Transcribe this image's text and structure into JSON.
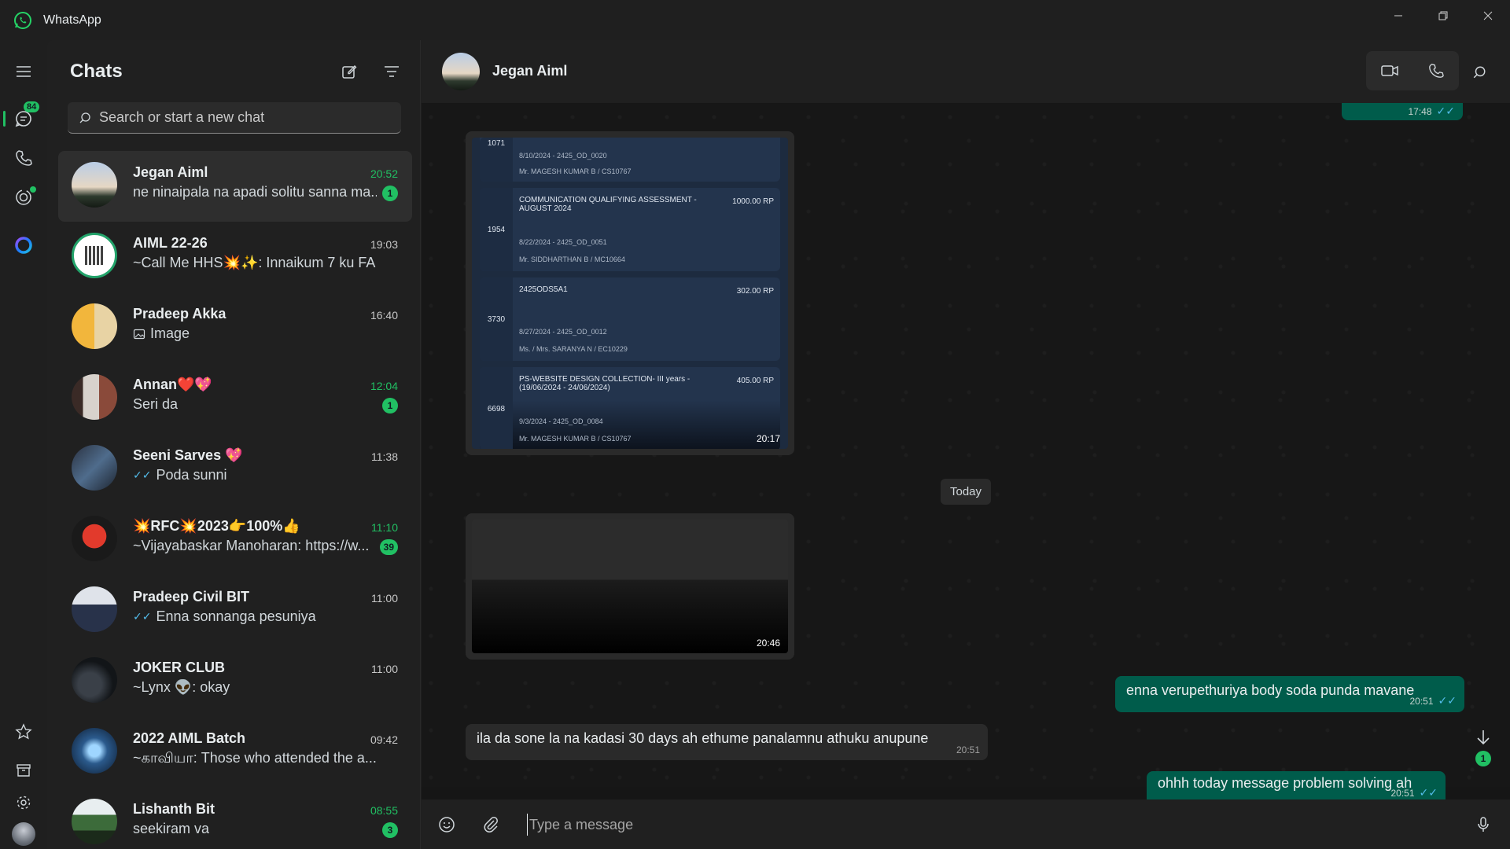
{
  "window": {
    "title": "WhatsApp",
    "controls": [
      "minimize",
      "restore",
      "close"
    ]
  },
  "rail": {
    "chats_badge": "84",
    "items": [
      {
        "name": "menu"
      },
      {
        "name": "chats"
      },
      {
        "name": "calls"
      },
      {
        "name": "status"
      },
      {
        "name": "meta-ai"
      },
      {
        "name": "starred"
      },
      {
        "name": "archived"
      },
      {
        "name": "settings"
      },
      {
        "name": "profile"
      }
    ]
  },
  "chatlist": {
    "title": "Chats",
    "search_placeholder": "Search or start a new chat",
    "chats": [
      {
        "name": "Jegan Aiml",
        "preview": "ne ninaipala na apadi solitu sanna ma...",
        "time": "20:52",
        "unread": "1",
        "has_ticks": false
      },
      {
        "name": "AIML 22-26",
        "preview": "~Call Me HHS💥✨: Innaikum 7 ku FA",
        "time": "19:03",
        "unread": "",
        "has_ticks": false
      },
      {
        "name": "Pradeep Akka",
        "preview": "Image",
        "time": "16:40",
        "unread": "",
        "has_ticks": false,
        "image_icon": true
      },
      {
        "name": "Annan❤️💖",
        "preview": "Seri da",
        "time": "12:04",
        "unread": "1",
        "has_ticks": false
      },
      {
        "name": "Seeni Sarves 💖",
        "preview": "Poda sunni",
        "time": "11:38",
        "unread": "",
        "has_ticks": true
      },
      {
        "name": "💥RFC💥2023👉100%👍",
        "preview": "~Vijayabaskar Manoharan: https://w...",
        "time": "11:10",
        "unread": "39",
        "has_ticks": false
      },
      {
        "name": "Pradeep Civil BIT",
        "preview": "Enna sonnanga pesuniya",
        "time": "11:00",
        "unread": "",
        "has_ticks": true
      },
      {
        "name": "JOKER CLUB",
        "preview": "~Lynx 👽: okay",
        "time": "11:00",
        "unread": "",
        "has_ticks": false
      },
      {
        "name": "2022 AIML Batch",
        "preview": "~காவியா: Those who attended the a...",
        "time": "09:42",
        "unread": "",
        "has_ticks": false
      },
      {
        "name": "Lishanth Bit",
        "preview": "seekiram va",
        "time": "08:55",
        "unread": "3",
        "has_ticks": false
      }
    ]
  },
  "conversation": {
    "contact_name": "Jegan Aiml",
    "top_partial_time": "17:48",
    "receipt_image": {
      "time": "20:17",
      "rows": [
        {
          "num": "1071",
          "line1": "",
          "amount": "",
          "line2": "8/10/2024 - 2425_OD_0020",
          "line3": "Mr. MAGESH KUMAR B / CS10767"
        },
        {
          "num": "1954",
          "line1": "COMMUNICATION QUALIFYING ASSESSMENT - AUGUST 2024",
          "amount": "1000.00 RP",
          "line2": "8/22/2024 - 2425_OD_0051",
          "line3": "Mr. SIDDHARTHAN B / MC10664"
        },
        {
          "num": "3730",
          "line1": "2425ODS5A1",
          "amount": "302.00 RP",
          "line2": "8/27/2024 - 2425_OD_0012",
          "line3": "Ms. / Mrs. SARANYA N / EC10229"
        },
        {
          "num": "6698",
          "line1": "PS-WEBSITE DESIGN COLLECTION- III years - (19/06/2024 - 24/06/2024)",
          "amount": "405.00 RP",
          "line2": "9/3/2024 - 2425_OD_0084",
          "line3": "Mr. MAGESH KUMAR B / CS10767"
        }
      ]
    },
    "date_chip": "Today",
    "dark_image_time": "20:46",
    "messages": [
      {
        "dir": "out",
        "text": "enna verupethuriya body soda punda mavane",
        "time": "20:51"
      },
      {
        "dir": "in",
        "text": "ila da sone la na kadasi 30 days ah ethume panalamnu athuku anupune",
        "time": "20:51"
      },
      {
        "dir": "out",
        "text": "ohhh today message problem solving ah",
        "time": "20:51"
      }
    ],
    "scroll_badge": "1",
    "composer_placeholder": "Type a message"
  },
  "colors": {
    "accent": "#21c063",
    "outgoing_bubble": "#005c4b",
    "incoming_bubble": "#2a2a2a",
    "ticks": "#53bdeb"
  }
}
